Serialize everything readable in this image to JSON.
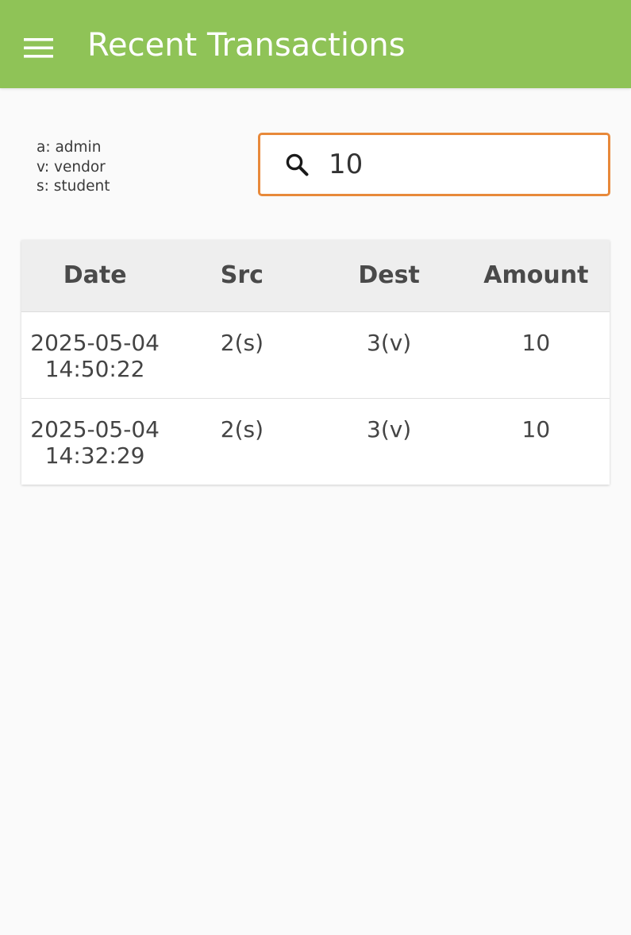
{
  "app_bar": {
    "title": "Recent Transactions",
    "menu_icon": "hamburger-menu-icon",
    "background_color": "#8fc357"
  },
  "legend": [
    "a: admin",
    "v: vendor",
    "s: student"
  ],
  "search": {
    "icon": "search-icon",
    "value": "10",
    "placeholder": "",
    "border_color": "#e8893a"
  },
  "table": {
    "headers": [
      "Date",
      "Src",
      "Dest",
      "Amount"
    ],
    "rows": [
      {
        "date": "2025-05-04",
        "time": "14:50:22",
        "src": "2(s)",
        "dest": "3(v)",
        "amount": "10"
      },
      {
        "date": "2025-05-04",
        "time": "14:32:29",
        "src": "2(s)",
        "dest": "3(v)",
        "amount": "10"
      }
    ]
  }
}
